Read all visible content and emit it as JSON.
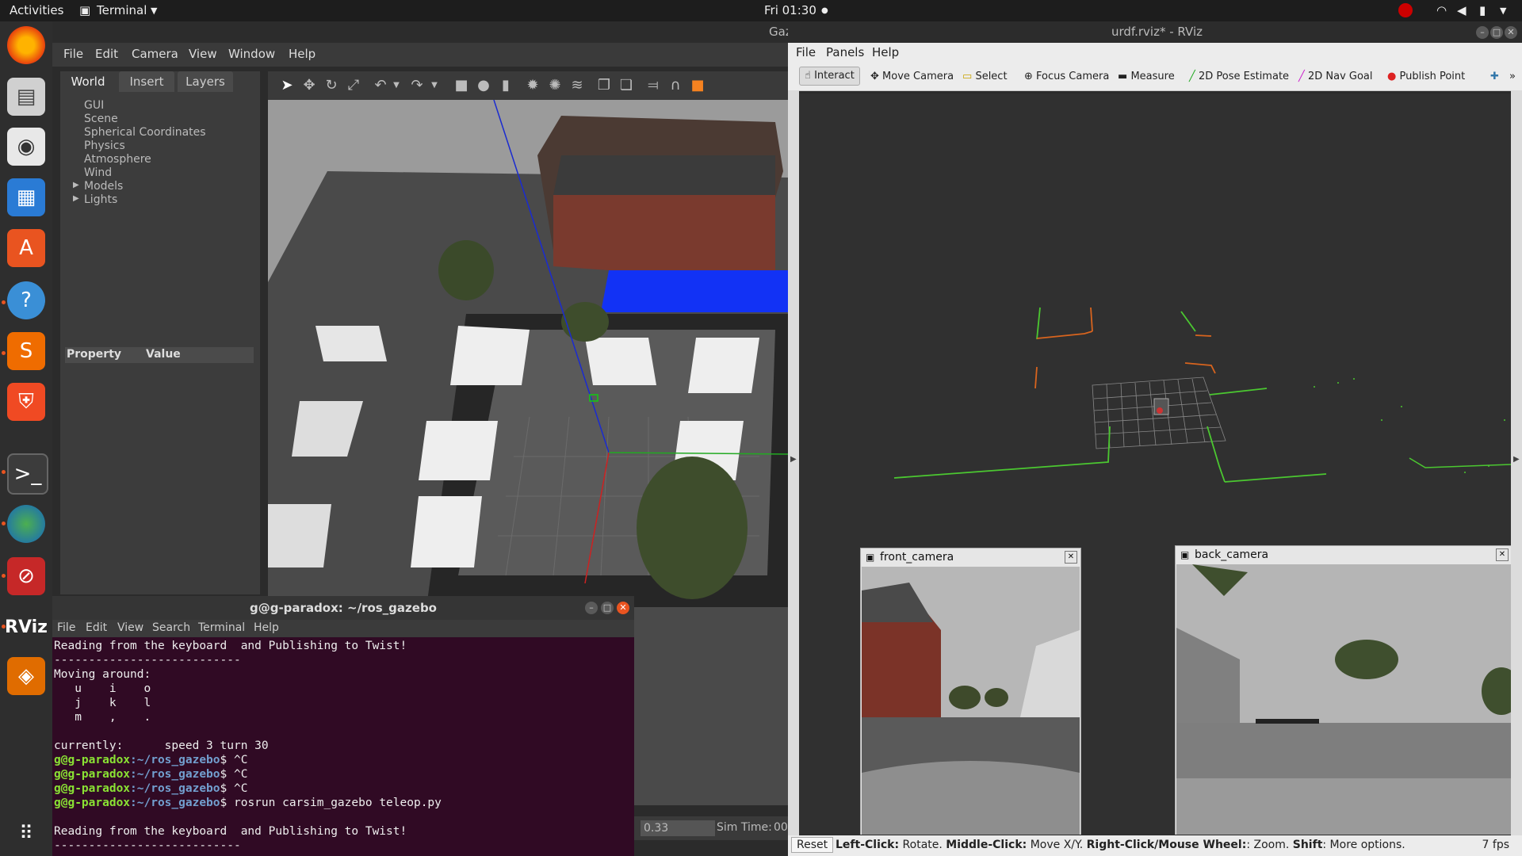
{
  "topbar": {
    "activities": "Activities",
    "app": "Terminal",
    "clock": "Fri 01:30"
  },
  "dock": {
    "items": [
      "firefox-icon",
      "files-icon",
      "rhythmbox-icon",
      "writer-icon",
      "software-icon",
      "help-icon",
      "sublime-icon",
      "brave-icon",
      "terminal-icon",
      "globe-icon",
      "gazebo-app-icon",
      "rviz-icon",
      "amazon-icon",
      "apps-grid-icon"
    ],
    "rviz_label": "RViz"
  },
  "gazebo": {
    "title": "Gaz",
    "menu": [
      "File",
      "Edit",
      "Camera",
      "View",
      "Window",
      "Help"
    ],
    "tabs": [
      "World",
      "Insert",
      "Layers"
    ],
    "tree": [
      "GUI",
      "Scene",
      "Spherical Coordinates",
      "Physics",
      "Atmosphere",
      "Wind",
      "Models",
      "Lights"
    ],
    "prop_headers": [
      "Property",
      "Value"
    ],
    "rtf": "0.33",
    "sim_time_label": "Sim Time:",
    "sim_time_value": "00"
  },
  "terminal": {
    "title": "g@g-paradox: ~/ros_gazebo",
    "menu": [
      "File",
      "Edit",
      "View",
      "Search",
      "Terminal",
      "Help"
    ],
    "lines": [
      "Reading from the keyboard  and Publishing to Twist!",
      "---------------------------",
      "Moving around:",
      "   u    i    o",
      "   j    k    l",
      "   m    ,    .",
      "",
      "currently:      speed 3 turn 30"
    ],
    "prompt_user": "g@g-paradox",
    "prompt_path": ":~/ros_gazebo",
    "prompt_commands": [
      "$ ^C",
      "$ ^C",
      "$ ^C",
      "$ rosrun carsim_gazebo teleop.py"
    ],
    "after_lines": [
      "",
      "Reading from the keyboard  and Publishing to Twist!",
      "---------------------------"
    ]
  },
  "rviz": {
    "title": "urdf.rviz* - RViz",
    "menu": [
      "File",
      "Panels",
      "Help"
    ],
    "tools": [
      "Interact",
      "Move Camera",
      "Select",
      "Focus Camera",
      "Measure",
      "2D Pose Estimate",
      "2D Nav Goal",
      "Publish Point"
    ],
    "front_camera": "front_camera",
    "back_camera": "back_camera",
    "reset": "Reset",
    "status_b1": "Left-Click:",
    "status_t1": " Rotate. ",
    "status_b2": "Middle-Click:",
    "status_t2": " Move X/Y. ",
    "status_b3": "Right-Click/Mouse Wheel:",
    "status_t3": ": Zoom. ",
    "status_b4": "Shift",
    "status_t4": ": More options.",
    "fps": "7 fps"
  }
}
